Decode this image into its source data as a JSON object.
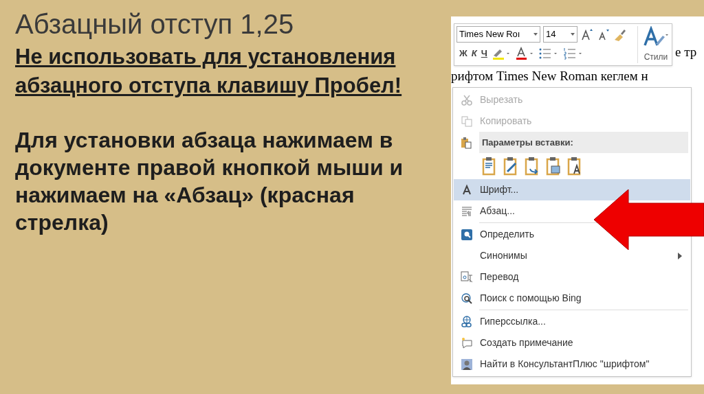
{
  "slide": {
    "title": "Абзацный отступ 1,25",
    "warning": "Не использовать для установления абзацного отступа клавишу Пробел!",
    "instruction": "Для установки абзаца нажимаем в документе правой кнопкой мыши и нажимаем на «Абзац» (красная стрелка)"
  },
  "document": {
    "lines": [
      "е тр",
      "рифтом Times New Roman кеглем н"
    ]
  },
  "toolbar": {
    "font": "Times New Roı",
    "size": "14",
    "bold": "Ж",
    "italic": "К",
    "underline": "Ч",
    "styles_label": "Стили"
  },
  "context_menu": {
    "items": [
      {
        "kind": "item",
        "label": "Вырезать",
        "disabled": true,
        "selected": false,
        "submenu": false
      },
      {
        "kind": "item",
        "label": "Копировать",
        "disabled": true,
        "selected": false,
        "submenu": false
      },
      {
        "kind": "header",
        "label": "Параметры вставки:"
      },
      {
        "kind": "paste_options"
      },
      {
        "kind": "item",
        "label": "Шрифт...",
        "disabled": false,
        "selected": true,
        "submenu": false
      },
      {
        "kind": "item",
        "label": "Абзац...",
        "disabled": false,
        "selected": false,
        "submenu": false
      },
      {
        "kind": "separator"
      },
      {
        "kind": "item",
        "label": "Определить",
        "disabled": false,
        "selected": false,
        "submenu": false
      },
      {
        "kind": "item",
        "label": "Синонимы",
        "disabled": false,
        "selected": false,
        "submenu": true
      },
      {
        "kind": "item",
        "label": "Перевод",
        "disabled": false,
        "selected": false,
        "submenu": false
      },
      {
        "kind": "item",
        "label": "Поиск с помощью Bing",
        "disabled": false,
        "selected": false,
        "submenu": false
      },
      {
        "kind": "separator"
      },
      {
        "kind": "item",
        "label": "Гиперссылка...",
        "disabled": false,
        "selected": false,
        "submenu": false
      },
      {
        "kind": "item",
        "label": "Создать примечание",
        "disabled": false,
        "selected": false,
        "submenu": false
      },
      {
        "kind": "item",
        "label": "Найти в КонсультантПлюс \"шрифтом\"",
        "disabled": false,
        "selected": false,
        "submenu": false
      }
    ]
  }
}
